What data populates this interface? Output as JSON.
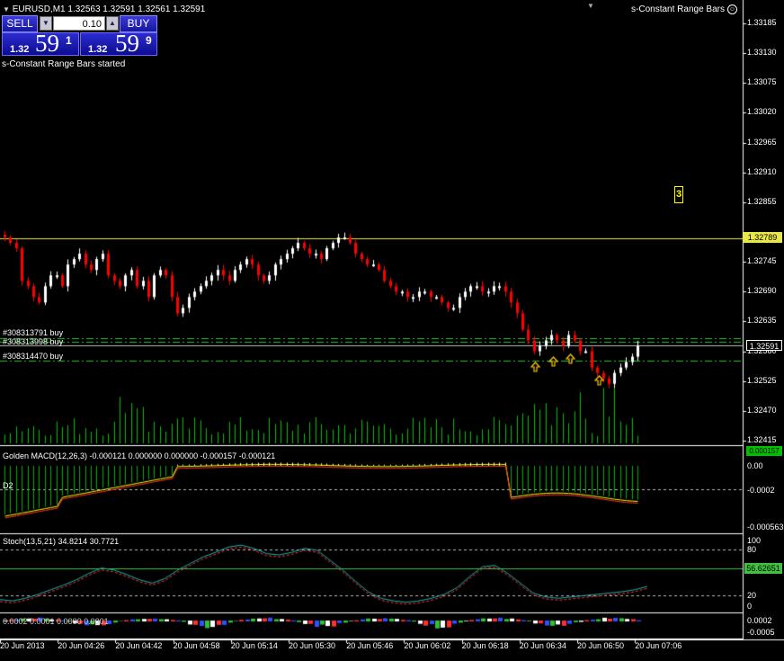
{
  "header": {
    "symbol_info": "EURUSD,M1  1.32563 1.32591 1.32561 1.32591",
    "indicator_name": "s-Constant Range Bars",
    "started_msg": "s-Constant Range Bars started"
  },
  "trade_panel": {
    "sell_label": "SELL",
    "buy_label": "BUY",
    "lot": "0.10",
    "sell_price": {
      "prefix": "1.32",
      "big": "59",
      "sup": "1"
    },
    "buy_price": {
      "prefix": "1.32",
      "big": "59",
      "sup": "9"
    }
  },
  "marker_label": "3",
  "main_axis": {
    "ticks": [
      "1.33185",
      "1.33130",
      "1.33075",
      "1.33020",
      "1.32965",
      "1.32910",
      "1.32855",
      "1.32745",
      "1.32690",
      "1.32635",
      "1.32580",
      "1.32525",
      "1.32470",
      "1.32415"
    ],
    "tick_values": [
      1.33185,
      1.3313,
      1.33075,
      1.3302,
      1.32965,
      1.3291,
      1.32855,
      1.32745,
      1.3269,
      1.32635,
      1.3258,
      1.32525,
      1.3247,
      1.32415
    ],
    "level_label": "1.32789",
    "current_label": "1.32591"
  },
  "orders": [
    {
      "label": "#308313791 buy"
    },
    {
      "label": "#308313998 buy"
    },
    {
      "label": "#308314470 buy"
    }
  ],
  "macd": {
    "title": "Golden MACD(12,26,3) -0.000121 0.000000 0.000000 -0.000157 -0.000121",
    "side_label": "D2",
    "ticks": [
      "0.000157",
      "0.00",
      "-0.0002",
      "-0.000563"
    ]
  },
  "stoch": {
    "title": "Stoch(13,5,21) 34.8214 30.7721",
    "ticks": [
      "100",
      "80",
      "20",
      "0"
    ],
    "level_label": "56.62651"
  },
  "osc4": {
    "title": "0.0002 0.0001 0.0000 0.0001",
    "ticks": [
      "0.0002",
      "-0.0005"
    ]
  },
  "time_axis": {
    "labels": [
      "20 Jun 2013",
      "20 Jun 04:26",
      "20 Jun 04:42",
      "20 Jun 04:58",
      "20 Jun 05:14",
      "20 Jun 05:30",
      "20 Jun 05:46",
      "20 Jun 06:02",
      "20 Jun 06:18",
      "20 Jun 06:34",
      "20 Jun 06:50",
      "20 Jun 07:06"
    ]
  },
  "colors": {
    "background": "#000000",
    "bull_candle": "#ffffff",
    "bear_candle": "#ff0000",
    "volume": "#00c000",
    "level_line": "#e8e84a",
    "order_line": "#30c030",
    "macd_hist": "#00b000",
    "stoch_main": "#20b0b0",
    "stoch_signal": "#ff3030",
    "stoch_level": "#40c040",
    "marker": "#ffff00"
  },
  "chart_data": {
    "type": "candlestick",
    "close_series": [
      1.3279,
      1.3278,
      1.3277,
      1.3271,
      1.327,
      1.3268,
      1.3267,
      1.327,
      1.3272,
      1.3272,
      1.327,
      1.3274,
      1.3275,
      1.3276,
      1.3274,
      1.3273,
      1.3275,
      1.3276,
      1.3272,
      1.3271,
      1.327,
      1.3272,
      1.3273,
      1.327,
      1.3271,
      1.3268,
      1.3272,
      1.3273,
      1.3272,
      1.3268,
      1.3265,
      1.3266,
      1.3268,
      1.3269,
      1.327,
      1.3271,
      1.3272,
      1.3273,
      1.3272,
      1.3271,
      1.3273,
      1.3274,
      1.3275,
      1.3274,
      1.3272,
      1.3271,
      1.3272,
      1.3274,
      1.3275,
      1.3276,
      1.3277,
      1.3278,
      1.3277,
      1.3276,
      1.3276,
      1.3275,
      1.3277,
      1.3278,
      1.3279,
      1.3279,
      1.3278,
      1.3276,
      1.3275,
      1.3274,
      1.3274,
      1.3273,
      1.3271,
      1.327,
      1.3269,
      1.3269,
      1.3268,
      1.3268,
      1.3269,
      1.3269,
      1.3268,
      1.3268,
      1.3267,
      1.3266,
      1.3266,
      1.3268,
      1.3269,
      1.327,
      1.327,
      1.3269,
      1.3269,
      1.327,
      1.327,
      1.3269,
      1.3267,
      1.3265,
      1.3262,
      1.326,
      1.3258,
      1.3259,
      1.326,
      1.3261,
      1.326,
      1.3259,
      1.3261,
      1.326,
      1.3258,
      1.3258,
      1.3255,
      1.3254,
      1.3253,
      1.3252,
      1.3254,
      1.3255,
      1.3256,
      1.3257,
      1.3259
    ],
    "ylim": [
      1.32415,
      1.33185
    ],
    "levels": [
      1.32789,
      1.32591
    ]
  }
}
